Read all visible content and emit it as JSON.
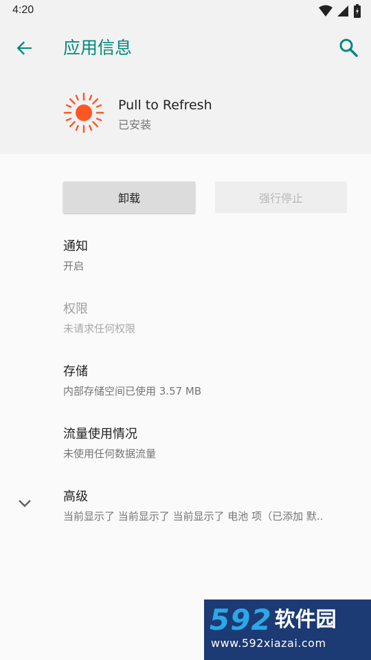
{
  "status_bar": {
    "time": "4:20"
  },
  "header": {
    "title": "应用信息"
  },
  "app": {
    "name": "Pull to Refresh",
    "state": "已安装"
  },
  "buttons": {
    "uninstall": "卸载",
    "force_stop": "强行停止"
  },
  "items": [
    {
      "title": "通知",
      "subtitle": "开启"
    },
    {
      "title": "权限",
      "subtitle": "未请求任何权限"
    },
    {
      "title": "存储",
      "subtitle": "内部存储空间已使用 3.57 MB"
    },
    {
      "title": "流量使用情况",
      "subtitle": "未使用任何数据流量"
    },
    {
      "title": "高级",
      "subtitle": "当前显示了 当前显示了 当前显示了 电池 项（已添加 默.."
    }
  ],
  "watermark": {
    "brand_num": "592",
    "brand_cn": "软件园",
    "url": "www.592xiazai.com"
  },
  "colors": {
    "accent": "#00897b",
    "app_icon": "#ff5722",
    "watermark_bg": "#1c3a73"
  },
  "icons": [
    "back-arrow-icon",
    "search-icon",
    "sun-icon",
    "chevron-down-icon",
    "wifi-icon",
    "signal-icon",
    "battery-icon"
  ]
}
